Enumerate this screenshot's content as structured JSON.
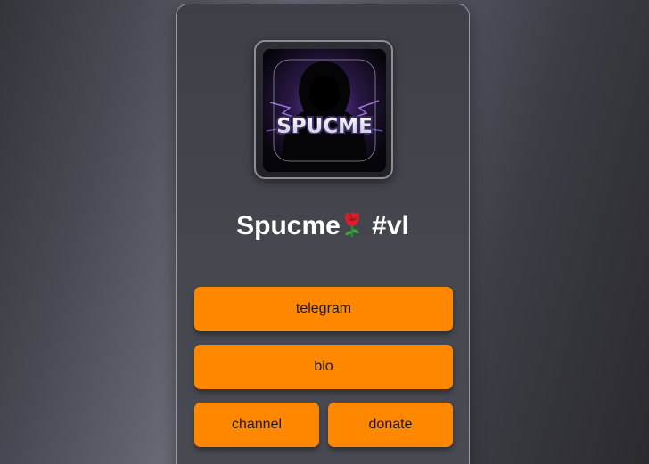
{
  "profile": {
    "avatar_text": "SPUCME",
    "name": "Spucme",
    "tag": "#vl"
  },
  "links": {
    "telegram": "telegram",
    "bio": "bio",
    "channel": "channel",
    "donate": "donate"
  },
  "colors": {
    "button": "#ff8800",
    "card": "#45454e",
    "title": "#ffffff"
  },
  "icons": {
    "title_emoji": "rose-icon"
  }
}
